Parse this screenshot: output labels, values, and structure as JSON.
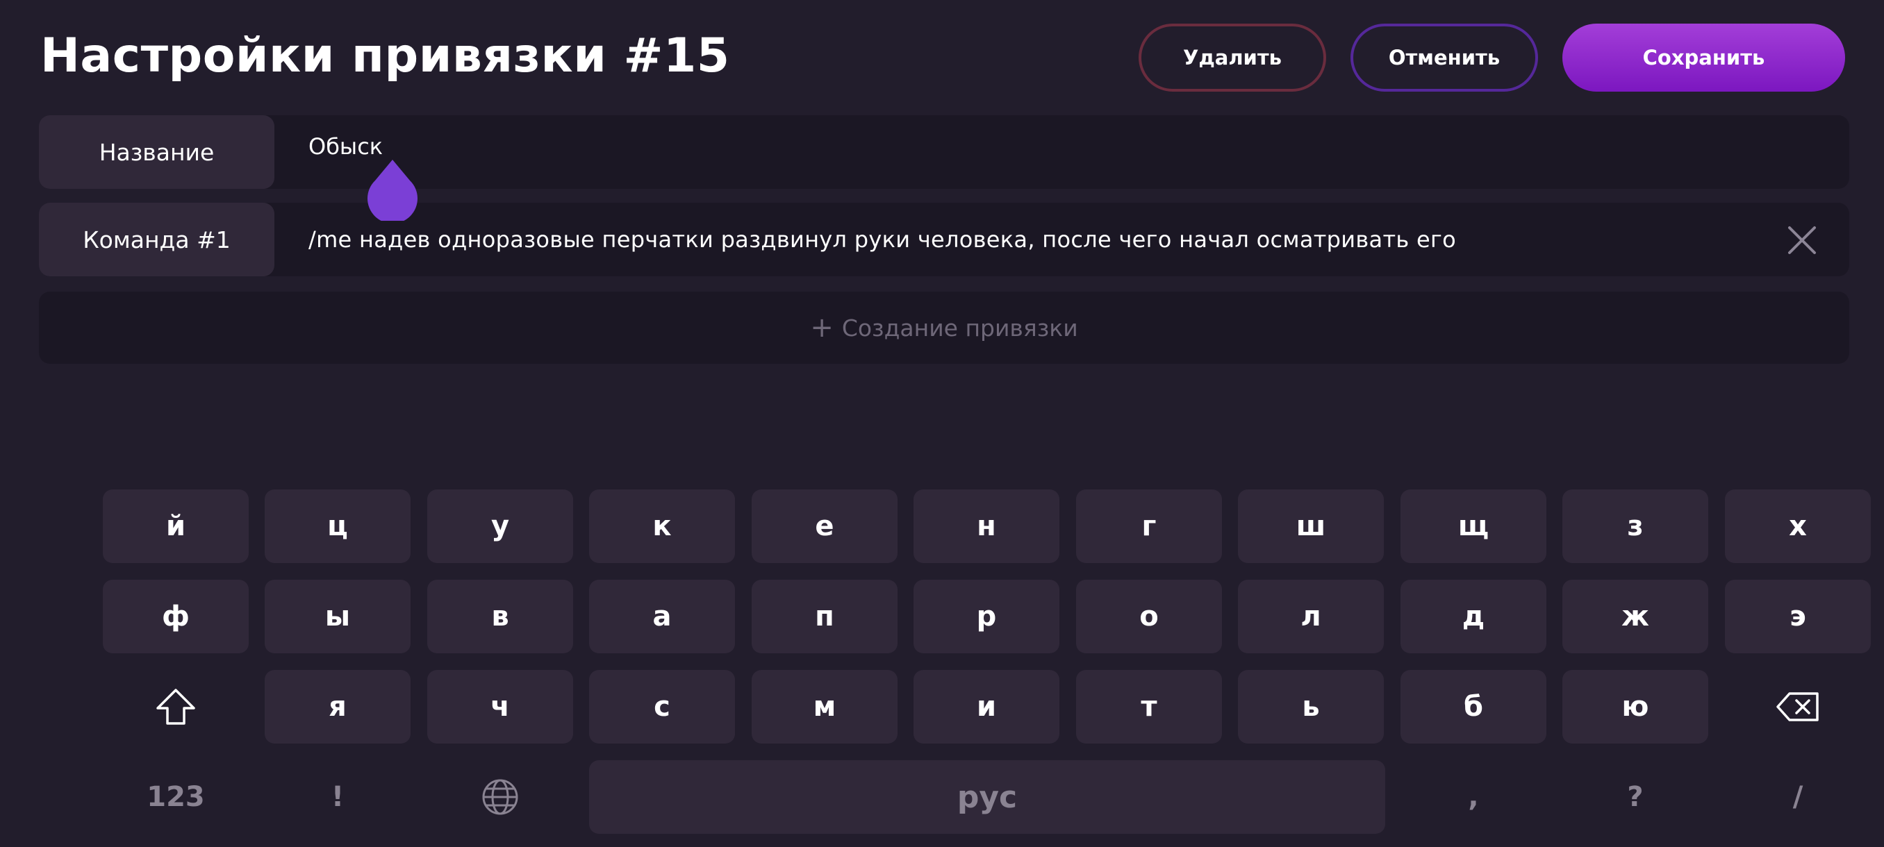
{
  "header": {
    "title": "Настройки привязки #15",
    "delete_label": "Удалить",
    "cancel_label": "Отменить",
    "save_label": "Сохранить"
  },
  "fields": {
    "name": {
      "label": "Название",
      "value": "Обыск"
    },
    "command": {
      "label": "Команда #1",
      "value": "/me надев одноразовые перчатки раздвинул руки человека, после чего начал осматривать его"
    }
  },
  "add_binding_label": "Создание привязки",
  "keyboard": {
    "row1": [
      "й",
      "ц",
      "у",
      "к",
      "е",
      "н",
      "г",
      "ш",
      "щ",
      "з",
      "х"
    ],
    "row2": [
      "ф",
      "ы",
      "в",
      "а",
      "п",
      "р",
      "о",
      "л",
      "д",
      "ж",
      "э"
    ],
    "row3": [
      "я",
      "ч",
      "с",
      "м",
      "и",
      "т",
      "ь",
      "б",
      "ю"
    ],
    "numbers_label": "123",
    "exclaim_label": "!",
    "space_label": "рус",
    "comma_label": ",",
    "question_label": "?",
    "slash_label": "/"
  },
  "colors": {
    "background": "#221d2c",
    "accent": "#8a2fd0",
    "delete_border": "#6a2c3e",
    "cancel_border": "#55289a"
  },
  "icons": [
    "shift-icon",
    "backspace-icon",
    "globe-icon",
    "close-icon",
    "plus-icon",
    "text-cursor-handle-icon"
  ]
}
